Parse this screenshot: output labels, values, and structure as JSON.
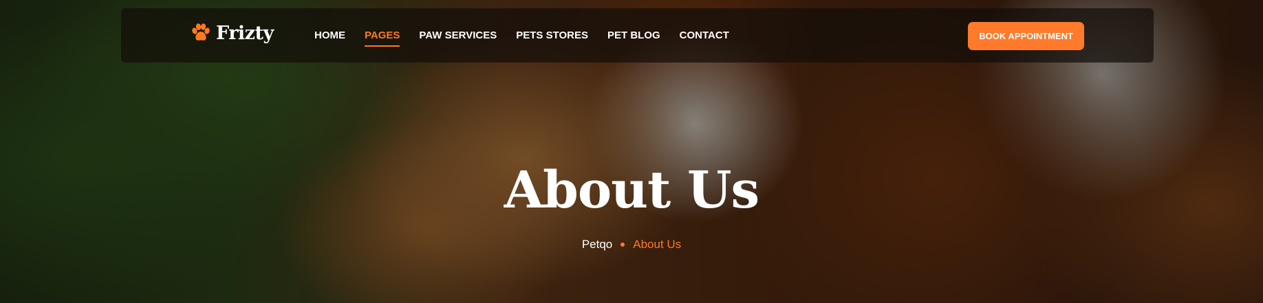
{
  "brand": {
    "name": "Frizty",
    "logo_icon": "paw-icon",
    "accent_color": "#ff7a2a"
  },
  "nav": {
    "items": [
      {
        "label": "HOME",
        "active": false
      },
      {
        "label": "PAGES",
        "active": true
      },
      {
        "label": "PAW SERVICES",
        "active": false
      },
      {
        "label": "PETS STORES",
        "active": false
      },
      {
        "label": "PET BLOG",
        "active": false
      },
      {
        "label": "CONTACT",
        "active": false
      }
    ],
    "cta_label": "BOOK APPOINTMENT"
  },
  "hero": {
    "title": "About Us",
    "breadcrumb": {
      "home": "Petqo",
      "current": "About Us"
    }
  }
}
